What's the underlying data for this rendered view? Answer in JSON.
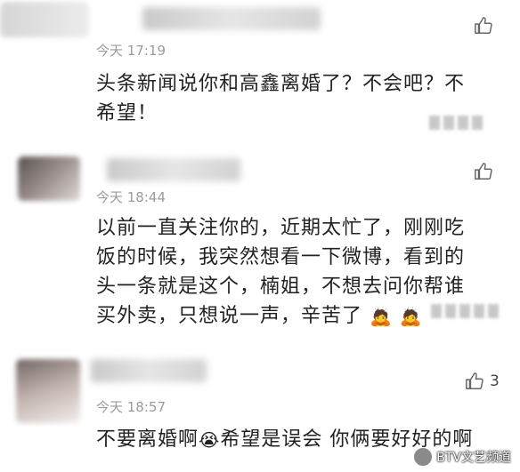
{
  "comments": [
    {
      "time": "今天 17:19",
      "text_line1": "头条新闻说你和高鑫离婚了？不会吧？不",
      "text_line2": "希望！",
      "like_count": ""
    },
    {
      "time": "今天 18:44",
      "text_line1": "以前一直关注你的，近期太忙了，刚刚吃",
      "text_line2": "饭的时候，我突然想看一下微博，看到的",
      "text_line3": "头一条就是这个，楠姐，不想去问你帮谁",
      "text_line4": "买外卖，只想说一声，辛苦了",
      "emoji1": "🙇",
      "emoji2": "🙇"
    },
    {
      "time": "今天 18:57",
      "text_part1": "不要离婚啊",
      "emoji": "😭",
      "text_part2": "希望是误会 你俩要好好的啊",
      "like_count": "3"
    }
  ],
  "watermark": "BTV文艺频道",
  "icons": {
    "like": "thumbs-up-icon"
  }
}
